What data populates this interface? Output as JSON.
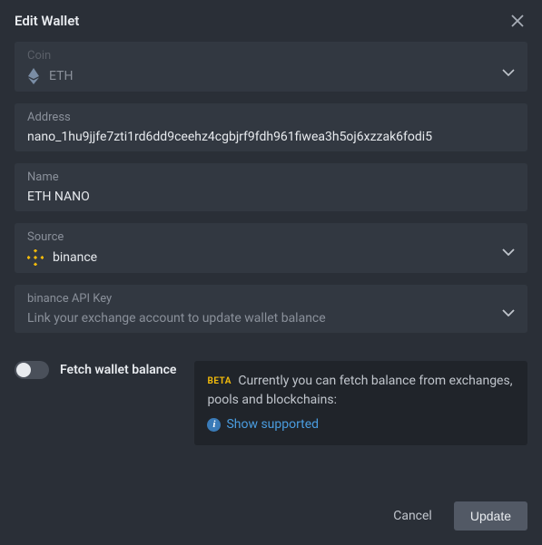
{
  "title": "Edit Wallet",
  "coin": {
    "label": "Coin",
    "value": "ETH"
  },
  "address": {
    "label": "Address",
    "value": "nano_1hu9jjfe7zti1rd6dd9ceehz4cgbjrf9fdh961fiwea3h5oj6xzzak6fodi5"
  },
  "name": {
    "label": "Name",
    "value": "ETH NANO"
  },
  "source": {
    "label": "Source",
    "value": "binance"
  },
  "apikey": {
    "label": "binance API Key",
    "placeholder": "Link your exchange account to update wallet balance"
  },
  "toggle": {
    "label": "Fetch wallet balance",
    "on": false
  },
  "info": {
    "badge": "BETA",
    "text": "Currently you can fetch balance from exchanges, pools and blockchains:",
    "link": "Show supported"
  },
  "buttons": {
    "cancel": "Cancel",
    "update": "Update"
  }
}
